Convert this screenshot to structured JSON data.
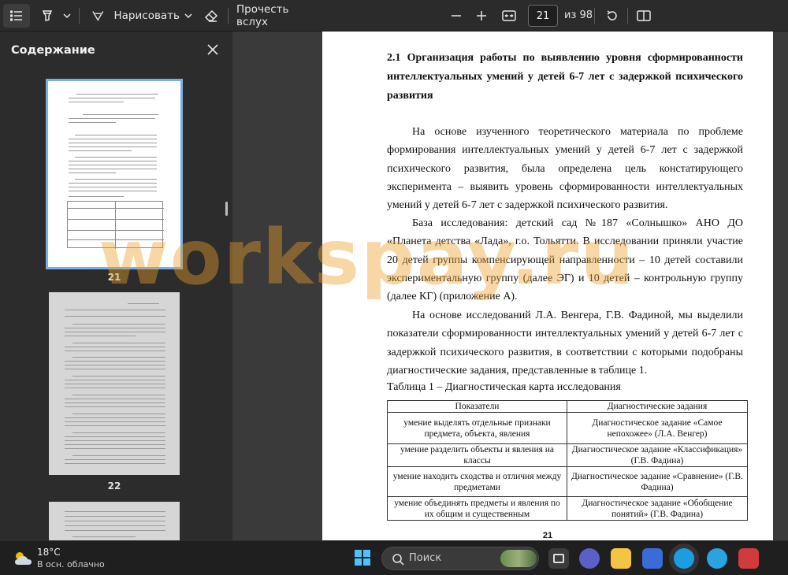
{
  "toolbar": {
    "draw_label": "Нарисовать",
    "read_aloud_label": "Прочесть вслух",
    "current_page": "21",
    "total_pages": "из 98"
  },
  "sidebar": {
    "title": "Содержание",
    "thumbnails": [
      {
        "page": "21",
        "selected": true
      },
      {
        "page": "22",
        "selected": false
      }
    ]
  },
  "document": {
    "heading": "2.1 Организация работы по выявлению уровня сформированности интеллектуальных умений у детей 6-7 лет с задержкой психического развития",
    "paragraphs": [
      "На основе изученного теоретического материала по проблеме формирования интеллектуальных умений у детей 6-7 лет с задержкой психического развития, была определена цель констатирующего эксперимента – выявить уровень сформированности интеллектуальных умений у детей 6-7 лет с задержкой психического развития.",
      "База исследования: детский сад №187 «Солнышко» АНО ДО «Планета детства «Лада», г.о. Тольятти. В исследовании приняли участие 20 детей группы компенсирующей направленности – 10 детей составили экспериментальную группу (далее ЭГ) и 10 детей – контрольную группу (далее КГ) (приложение А).",
      "На основе исследований Л.А. Венгера, Г.В. Фадиной, мы выделили показатели сформированности интеллектуальных умений у детей 6-7 лет с задержкой психического развития, в соответствии с которыми подобраны диагностические задания, представленные в таблице 1."
    ],
    "table_caption": "Таблица 1 – Диагностическая карта исследования",
    "table": {
      "headers": [
        "Показатели",
        "Диагностические задания"
      ],
      "rows": [
        [
          "умение выделять отдельные признаки предмета, объекта, явления",
          "Диагностическое задание «Самое непохожее» (Л.А. Венгер)"
        ],
        [
          "умение разделить объекты и явления на классы",
          "Диагностическое задание «Классификация» (Г.В. Фадина)"
        ],
        [
          "умение находить сходства и отличия между предметами",
          "Диагностическое задание «Сравнение» (Г.В. Фадина)"
        ],
        [
          "умение объединять предметы и явления по их общим и существенным",
          "Диагностическое задание «Обобщение понятий» (Г.В. Фадина)"
        ]
      ]
    },
    "page_number": "21"
  },
  "watermark": "workspay.ru",
  "taskbar": {
    "weather_temp": "18°C",
    "weather_desc": "В осн. облачно",
    "search_placeholder": "Поиск"
  }
}
